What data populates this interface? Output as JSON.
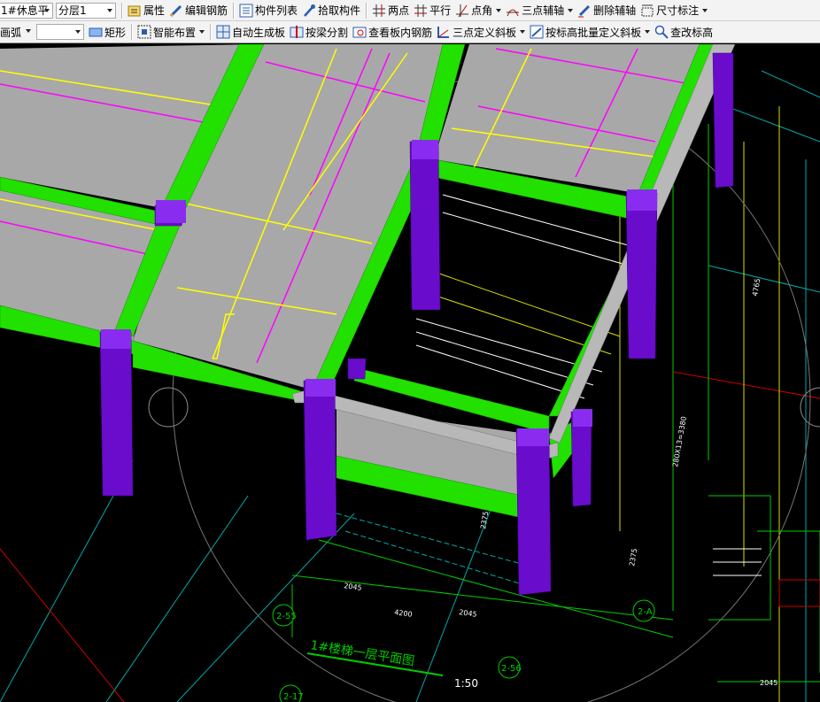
{
  "toolbar1": {
    "floor_select": "1#休息平",
    "layer_select": "分层1",
    "properties": "属性",
    "edit_rebar": "编辑钢筋",
    "component_list": "构件列表",
    "pick_component": "拾取构件",
    "two_points": "两点",
    "parallel": "平行",
    "point_angle": "点角",
    "three_point_axis": "三点辅轴",
    "delete_axis": "删除辅轴",
    "dimension": "尺寸标注"
  },
  "toolbar2": {
    "draw_mode": "画弧",
    "draw_value": "",
    "rectangle": "矩形",
    "smart_layout": "智能布置",
    "auto_generate_slab": "自动生成板",
    "split_by_beam": "按梁分割",
    "view_slab_rebar": "查看板内钢筋",
    "three_point_slope": "三点定义斜板",
    "batch_slope_by_elevation": "按标高批量定义斜板",
    "check_elevation": "查改标高"
  },
  "drawing": {
    "title": "1#楼梯一层平面图",
    "scale": "1:50",
    "axis_labels": [
      "2-55",
      "2-56",
      "2-A",
      "2-17"
    ],
    "dims": [
      "2045",
      "4200",
      "2045",
      "2375",
      "2375",
      "4765",
      "280X13=3380",
      "2045"
    ]
  },
  "colors": {
    "beam": "#22e000",
    "slab": "#a8a8a8",
    "column": "#6a0ccc",
    "background": "#000000"
  }
}
